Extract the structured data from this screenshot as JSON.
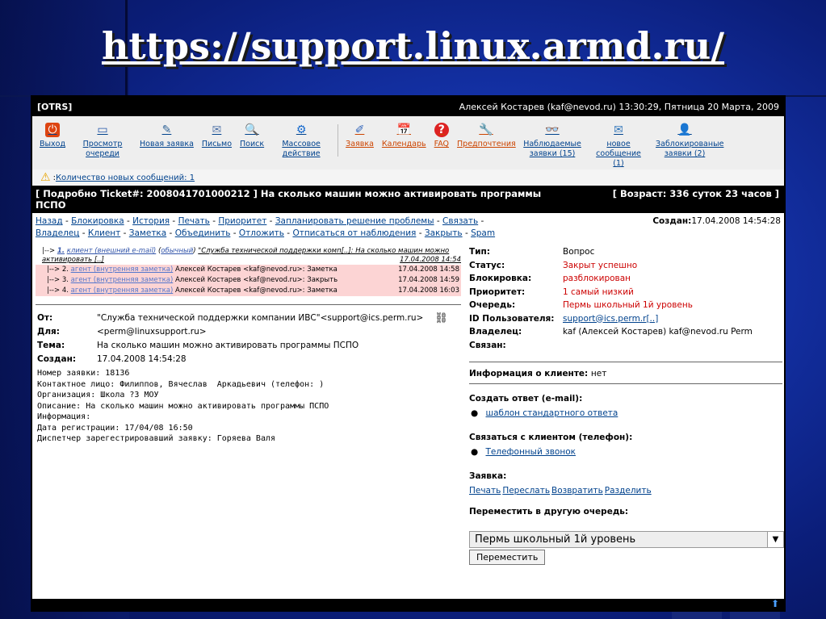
{
  "slide": {
    "title": "https://support.linux.armd.ru/"
  },
  "topbar": {
    "brand": "[OTRS]",
    "user_info": "Алексей Костарев (kaf@nevod.ru) 13:30:29, Пятница 20 Марта, 2009"
  },
  "toolbar": [
    {
      "label": "Выход",
      "icon": "power-icon"
    },
    {
      "label": "Просмотр очереди",
      "icon": "queue-window-icon"
    },
    {
      "label": "Новая заявка",
      "icon": "new-ticket-icon"
    },
    {
      "label": "Письмо",
      "icon": "email-icon"
    },
    {
      "label": "Поиск",
      "icon": "search-icon"
    },
    {
      "label": "Массовое действие",
      "icon": "bulk-action-icon"
    },
    {
      "label": "Заявка",
      "icon": "ticket-icon"
    },
    {
      "label": "Календарь",
      "icon": "calendar-icon"
    },
    {
      "label": "FAQ",
      "icon": "help-icon"
    },
    {
      "label": "Предпочтения",
      "icon": "preferences-icon"
    },
    {
      "label": "Наблюдаемые заявки (15)",
      "icon": "watched-icon"
    },
    {
      "label": "новое сообщение (1)",
      "icon": "new-message-icon"
    },
    {
      "label": "Заблокированые заявки (2)",
      "icon": "locked-icon"
    }
  ],
  "notice": {
    "prefix": ": ",
    "link": "Количество новых сообщений: 1"
  },
  "ticket": {
    "title": "[ Подробно Ticket#: 2008041701000212 ] На сколько машин можно активировать программы ПСПО",
    "age": "[ Возраст: 336 суток 23 часов ]",
    "created_label": "Создан:",
    "created_value": "17.04.2008 14:54:28"
  },
  "actions_line1": [
    "Назад",
    "Блокировка",
    "История",
    "Печать",
    "Приоритет",
    "Запланировать решение проблемы",
    "Связать"
  ],
  "actions_line2": [
    "Владелец",
    "Клиент",
    "Заметка",
    "Объединить",
    "Отложить",
    "Отписаться от наблюдения",
    "Закрыть",
    "Spam"
  ],
  "thread": {
    "first": {
      "prefix": "|-->",
      "num": "1.",
      "type": "клиент (внешний e-mail)",
      "mode": "обычный",
      "subject": "\"Служба технической поддержки комп[..]: На сколько машин можно активировать [..]",
      "date": "17.04.2008 14:54"
    },
    "subs": [
      {
        "prefix": "|--> 2.",
        "type": "агент (внутренняя заметка)",
        "text": "Алексей Костарев <kaf@nevod.ru>: Заметка",
        "date": "17.04.2008 14:58"
      },
      {
        "prefix": "|--> 3.",
        "type": "агент (внутренняя заметка)",
        "text": "Алексей Костарев <kaf@nevod.ru>: Закрыть",
        "date": "17.04.2008 14:59"
      },
      {
        "prefix": "|--> 4.",
        "type": "агент (внутренняя заметка)",
        "text": "Алексей Костарев <kaf@nevod.ru>: Заметка",
        "date": "17.04.2008 16:03"
      }
    ]
  },
  "message": {
    "from_label": "От:",
    "from_value": "\"Служба технической поддержки компании ИВС\"<support@ics.perm.ru>",
    "to_label": "Для:",
    "to_value": "<perm@linuxsupport.ru>",
    "subject_label": "Тема:",
    "subject_value": "На сколько машин можно активировать программы ПСПО",
    "created_label": "Создан:",
    "created_value": "17.04.2008 14:54:28",
    "body": "Номер заявки: 18136\nКонтактное лицо: Филиппов, Вячеслав  Аркадьевич (телефон: )\nОрганизация: Школа ?3 МОУ\nОписание: На сколько машин можно активировать программы ПСПО\nИнформация:\nДата регистрации: 17/04/08 16:50\nДиспетчер зарегестрировавший заявку: Горяева Валя"
  },
  "props": [
    {
      "k": "Тип:",
      "v": "Вопрос",
      "style": "plain"
    },
    {
      "k": "Статус:",
      "v": "Закрыт успешно",
      "style": "red"
    },
    {
      "k": "Блокировка:",
      "v": "разблокирован",
      "style": "red"
    },
    {
      "k": "Приоритет:",
      "v": "1 самый низкий",
      "style": "red"
    },
    {
      "k": "Очередь:",
      "v": "Пермь школьный 1й уровень",
      "style": "red"
    },
    {
      "k": "ID Пользователя:",
      "v": "support@ics.perm.r[..]",
      "style": "link"
    },
    {
      "k": "Владелец:",
      "v": "kaf (Алексей Костарев) kaf@nevod.ru Perm",
      "style": "plain"
    },
    {
      "k": "Связан:",
      "v": "",
      "style": "plain"
    }
  ],
  "customer_info": {
    "label": "Информация о клиенте:",
    "value": "нет"
  },
  "reply": {
    "label": "Создать ответ (e-mail):",
    "link": "шаблон стандартного ответа"
  },
  "phone": {
    "label": "Связаться с клиентом (телефон):",
    "link": "Телефонный звонок"
  },
  "ticket_actions": {
    "label": "Заявка:",
    "links": [
      "Печать",
      "Переслать",
      "Возвратить",
      "Разделить"
    ]
  },
  "move": {
    "label": "Переместить в другую очередь:",
    "selected": "Пермь школьный 1й уровень",
    "button": "Переместить"
  }
}
